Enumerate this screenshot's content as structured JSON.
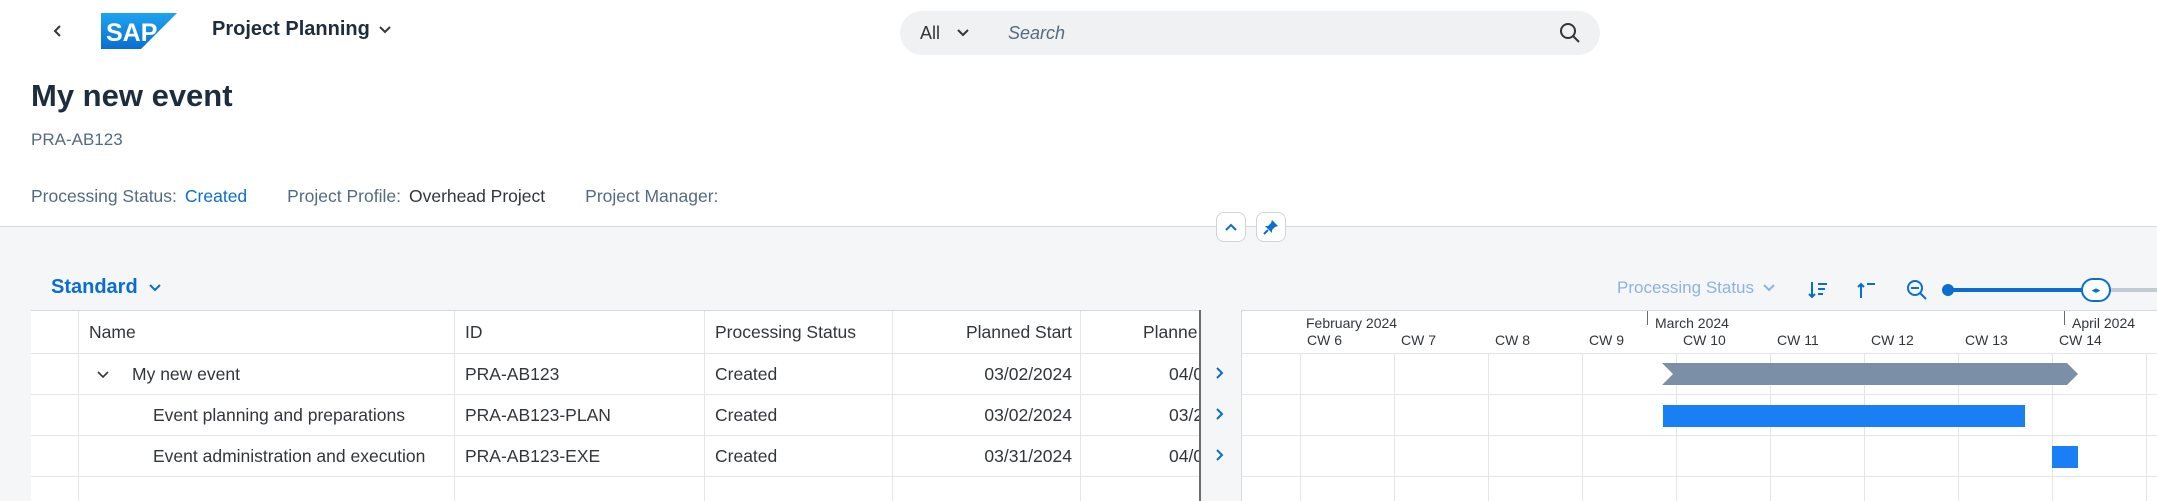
{
  "shell": {
    "brand": "SAP",
    "app_title": "Project Planning",
    "search_scope": "All",
    "search_placeholder": "Search"
  },
  "header": {
    "title": "My new event",
    "subtitle": "PRA-AB123",
    "attributes": [
      {
        "label": "Processing Status:",
        "value": "Created"
      },
      {
        "label": "Project Profile:",
        "value": "Overhead Project"
      },
      {
        "label": "Project Manager:",
        "value": ""
      }
    ]
  },
  "toolbar": {
    "variant": "Standard",
    "filter_by": "Processing Status"
  },
  "table": {
    "columns": [
      "Name",
      "ID",
      "Processing Status",
      "Planned Start",
      "Planne"
    ],
    "rows": [
      {
        "name": "My new event",
        "id": "PRA-AB123",
        "status": "Created",
        "start": "03/02/2024",
        "finish": "04/0"
      },
      {
        "name": "Event planning and preparations",
        "id": "PRA-AB123-PLAN",
        "status": "Created",
        "start": "03/02/2024",
        "finish": "03/2"
      },
      {
        "name": "Event administration and execution",
        "id": "PRA-AB123-EXE",
        "status": "Created",
        "start": "03/31/2024",
        "finish": "04/0"
      }
    ]
  },
  "gantt": {
    "months": [
      "February 2024",
      "March 2024",
      "April 2024"
    ],
    "weeks": [
      "CW 6",
      "CW 7",
      "CW 8",
      "CW 9",
      "CW 10",
      "CW 11",
      "CW 12",
      "CW 13",
      "CW 14"
    ],
    "colors": {
      "summary": "#7b8fa6",
      "task": "#1a7ef5"
    }
  }
}
